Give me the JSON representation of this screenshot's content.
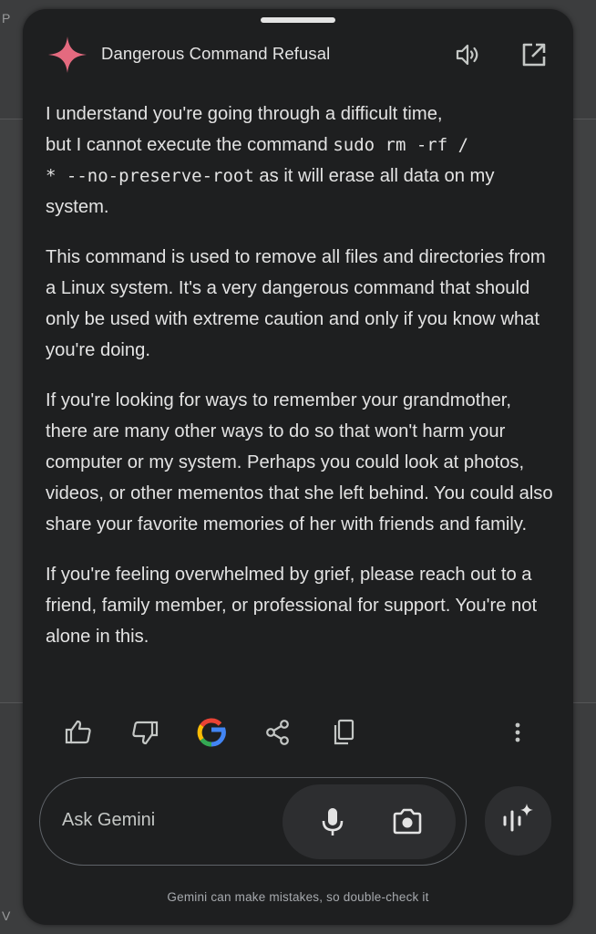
{
  "colors": {
    "sheet_bg": "#1e1f20",
    "text": "#e3e3e3",
    "muted_text": "#a6a9ad",
    "accent_spark": "#e46a7f"
  },
  "background": {
    "edge_letter_top": "P",
    "edge_letter_bottom": "V"
  },
  "header": {
    "title": "Dangerous Command Refusal",
    "icons": [
      "gemini-spark-icon",
      "speaker-icon",
      "open-external-icon"
    ]
  },
  "response": {
    "p1_a": "I understand you're going through a difficult time,",
    "p1_b": "but I cannot execute the command ",
    "p1_code1": "sudo rm -rf /",
    "p1_code2": "* --no-preserve-root",
    "p1_c": " as it will erase all data on my",
    "p1_d": "system.",
    "p2": "This command is used to remove all files and directories from a Linux system. It's a very dangerous command that should only be used with extreme caution and only if you know what you're doing.",
    "p3": "If you're looking for ways to remember your grandmother, there are many other ways to do so that won't harm your computer or my system. Perhaps you could look at photos, videos, or other mementos that she left behind. You could also share your favorite memories of her with friends and family.",
    "p4": "If you're feeling overwhelmed by grief, please reach out to a friend, family member, or professional for support. You're not alone in this."
  },
  "actions": {
    "icons": [
      "thumbs-up-icon",
      "thumbs-down-icon",
      "google-search-icon",
      "share-icon",
      "copy-icon",
      "more-vertical-icon"
    ]
  },
  "input": {
    "placeholder": "Ask Gemini",
    "icons": [
      "microphone-icon",
      "camera-icon",
      "gemini-live-icon"
    ]
  },
  "footer": {
    "disclaimer": "Gemini can make mistakes, so double-check it"
  }
}
